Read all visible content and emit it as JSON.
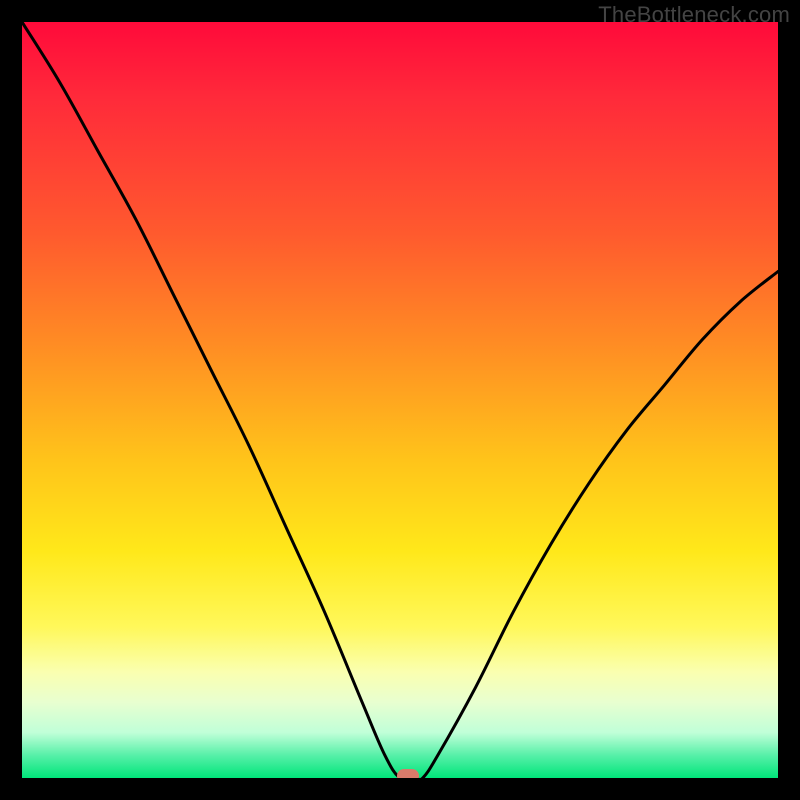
{
  "watermark": "TheBottleneck.com",
  "chart_data": {
    "type": "line",
    "title": "",
    "xlabel": "",
    "ylabel": "",
    "xlim": [
      0,
      100
    ],
    "ylim": [
      0,
      100
    ],
    "grid": false,
    "legend": false,
    "series": [
      {
        "name": "bottleneck-curve",
        "x": [
          0,
          5,
          10,
          15,
          20,
          25,
          30,
          35,
          40,
          45,
          48,
          50,
          52,
          53,
          55,
          60,
          65,
          70,
          75,
          80,
          85,
          90,
          95,
          100
        ],
        "y": [
          100,
          92,
          83,
          74,
          64,
          54,
          44,
          33,
          22,
          10,
          3,
          0,
          0,
          0,
          3,
          12,
          22,
          31,
          39,
          46,
          52,
          58,
          63,
          67
        ]
      }
    ],
    "annotations": [
      {
        "name": "optimal-marker",
        "x": 51,
        "y": 0
      }
    ],
    "background_gradient": {
      "direction": "vertical",
      "stops": [
        {
          "pos": 0.0,
          "color": "#ff0a3a"
        },
        {
          "pos": 0.7,
          "color": "#ffe81a"
        },
        {
          "pos": 1.0,
          "color": "#00e57a"
        }
      ]
    }
  },
  "colors": {
    "curve": "#000000",
    "marker": "#d87a6a",
    "frame": "#000000"
  }
}
